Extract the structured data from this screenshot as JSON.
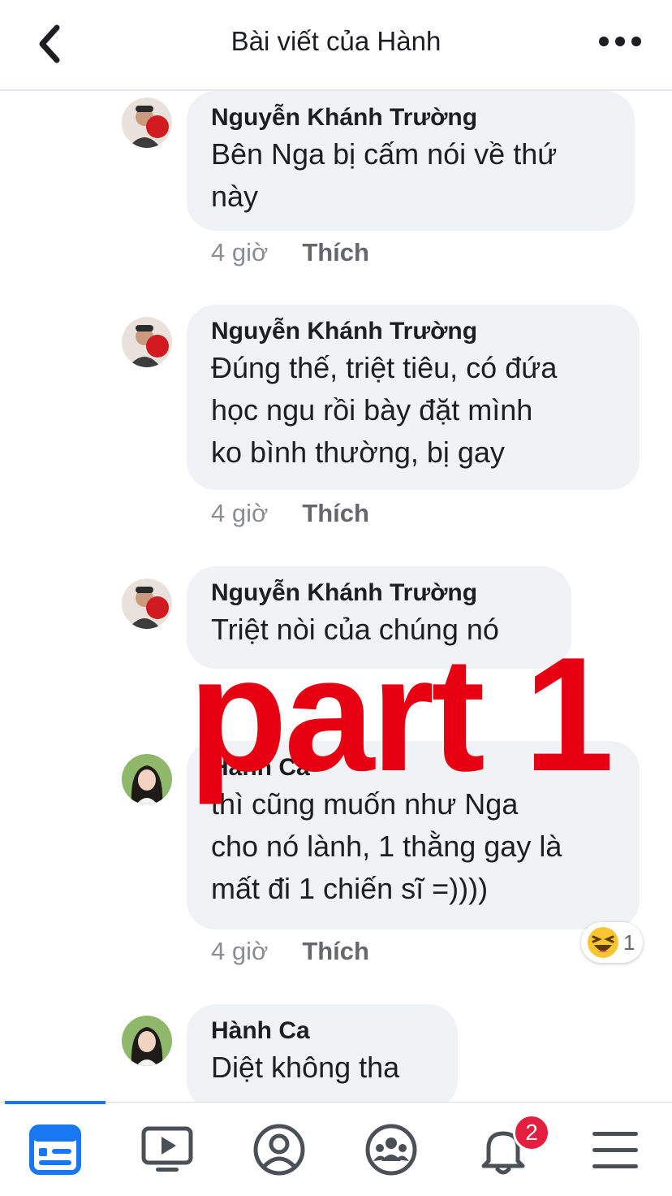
{
  "header": {
    "title": "Bài viết của Hành"
  },
  "comments": [
    {
      "author": "Nguyễn Khánh Trường",
      "lines": [
        "Bên Nga bị cấm nói về thứ",
        "này"
      ],
      "time": "4 giờ",
      "like": "Thích",
      "avatar": "man-avatar"
    },
    {
      "author": "Nguyễn Khánh Trường",
      "lines": [
        "Đúng thế, triệt tiêu, có đứa",
        "học ngu rồi bày đặt mình",
        "ko bình thường, bị gay"
      ],
      "time": "4 giờ",
      "like": "Thích",
      "avatar": "man-avatar"
    },
    {
      "author": "Nguyễn Khánh Trường",
      "lines": [
        "Triệt nòi của chúng nó"
      ],
      "avatar": "man-avatar"
    },
    {
      "author": "Hành Ca",
      "lines": [
        "thì cũng muốn như Nga",
        "cho nó lành, 1 thằng gay là",
        "mất đi 1 chiến sĩ =))))"
      ],
      "time": "4 giờ",
      "like": "Thích",
      "avatar": "woman-avatar",
      "reaction": {
        "icon": "haha-emoji-icon",
        "count": "1"
      }
    },
    {
      "author": "Hành Ca",
      "lines": [
        "Diệt không tha"
      ],
      "avatar": "woman-avatar"
    }
  ],
  "overlay": {
    "text": "part 1",
    "color": "#e60012"
  },
  "nav": {
    "items": [
      {
        "icon": "news-feed-icon",
        "active": true
      },
      {
        "icon": "watch-video-icon"
      },
      {
        "icon": "profile-icon"
      },
      {
        "icon": "groups-icon"
      },
      {
        "icon": "notifications-bell-icon",
        "badge": "2"
      },
      {
        "icon": "menu-icon"
      }
    ]
  },
  "colors": {
    "accent": "#1877f2",
    "bubble": "#f0f2f5",
    "badge": "#e41e3f"
  }
}
